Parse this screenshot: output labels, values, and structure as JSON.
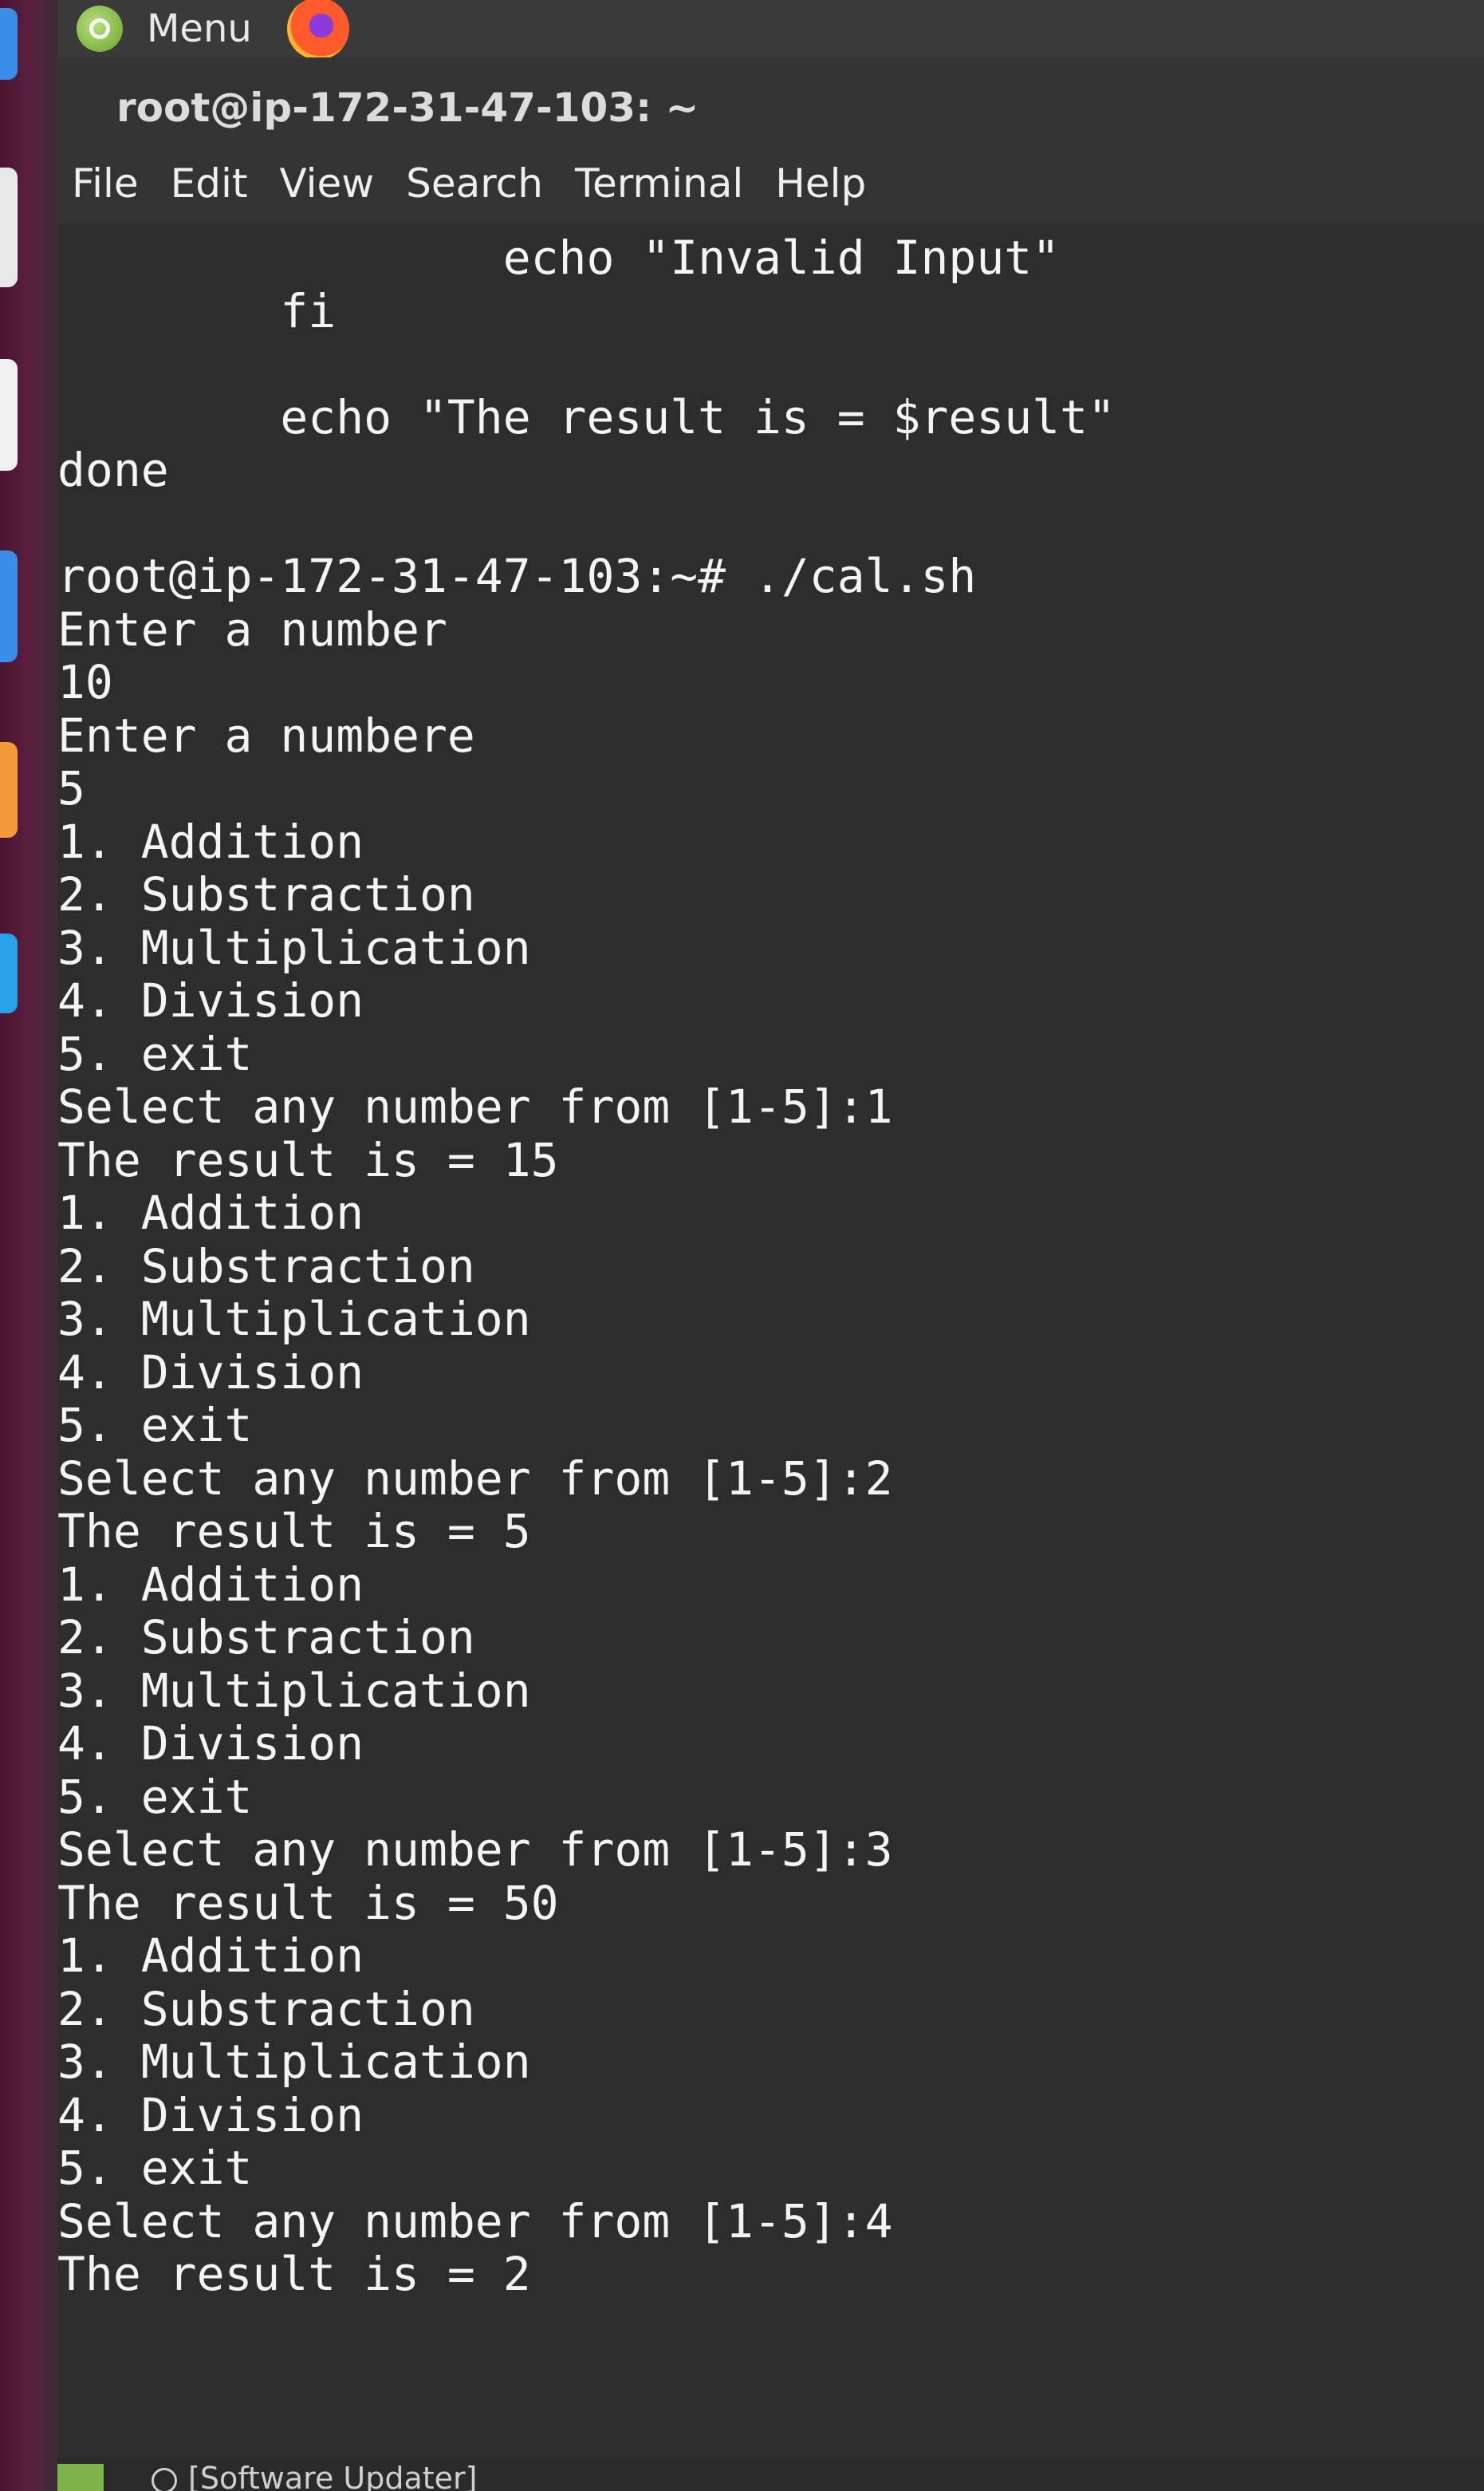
{
  "panel": {
    "menu_label": "Menu"
  },
  "window": {
    "title": "root@ip-172-31-47-103: ~"
  },
  "menubar": {
    "items": [
      "File",
      "Edit",
      "View",
      "Search",
      "Terminal",
      "Help"
    ]
  },
  "terminal": {
    "lines": [
      "                echo \"Invalid Input\"",
      "        fi",
      "",
      "        echo \"The result is = $result\"",
      "done",
      "",
      "root@ip-172-31-47-103:~# ./cal.sh",
      "Enter a number",
      "10",
      "Enter a numbere",
      "5",
      "1. Addition",
      "2. Substraction",
      "3. Multiplication",
      "4. Division",
      "5. exit",
      "Select any number from [1-5]:1",
      "The result is = 15",
      "1. Addition",
      "2. Substraction",
      "3. Multiplication",
      "4. Division",
      "5. exit",
      "Select any number from [1-5]:2",
      "The result is = 5",
      "1. Addition",
      "2. Substraction",
      "3. Multiplication",
      "4. Division",
      "5. exit",
      "Select any number from [1-5]:3",
      "The result is = 50",
      "1. Addition",
      "2. Substraction",
      "3. Multiplication",
      "4. Division",
      "5. exit",
      "Select any number from [1-5]:4",
      "The result is = 2"
    ]
  },
  "taskbar": {
    "item_label": "[Software Updater]"
  }
}
